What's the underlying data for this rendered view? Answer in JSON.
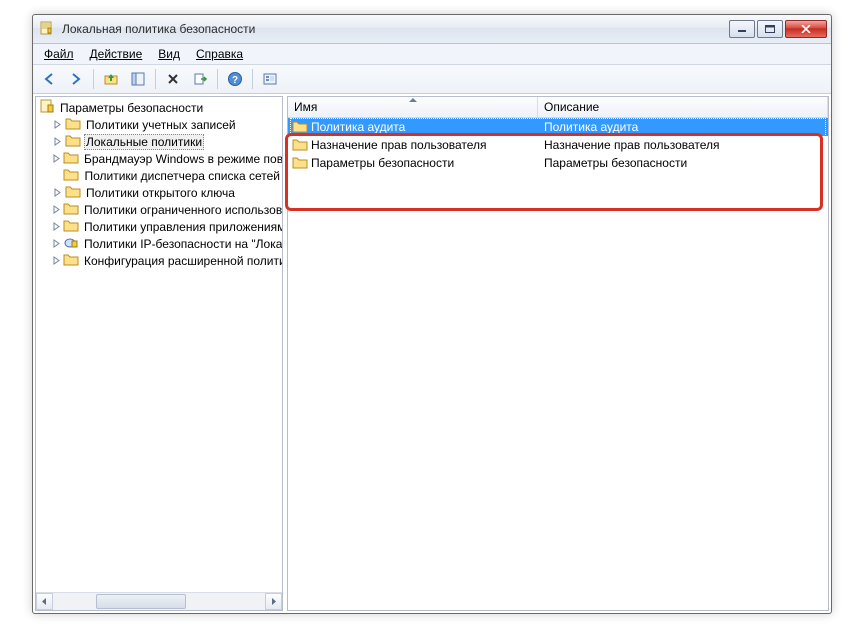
{
  "window": {
    "title": "Локальная политика безопасности"
  },
  "menu": {
    "file": "Файл",
    "action": "Действие",
    "view": "Вид",
    "help": "Справка"
  },
  "tree": {
    "root": "Параметры безопасности",
    "items": [
      "Политики учетных записей",
      "Локальные политики",
      "Брандмауэр Windows в режиме повышенной безопасности",
      "Политики диспетчера списка сетей",
      "Политики открытого ключа",
      "Политики ограниченного использования программ",
      "Политики управления приложениями",
      "Политики IP-безопасности на \"Локальный компьютер\"",
      "Конфигурация расширенной политики аудита"
    ]
  },
  "columns": {
    "name": "Имя",
    "desc": "Описание"
  },
  "rows": [
    {
      "name": "Политика аудита",
      "desc": "Политика аудита"
    },
    {
      "name": "Назначение прав пользователя",
      "desc": "Назначение прав пользователя"
    },
    {
      "name": "Параметры безопасности",
      "desc": "Параметры безопасности"
    }
  ]
}
